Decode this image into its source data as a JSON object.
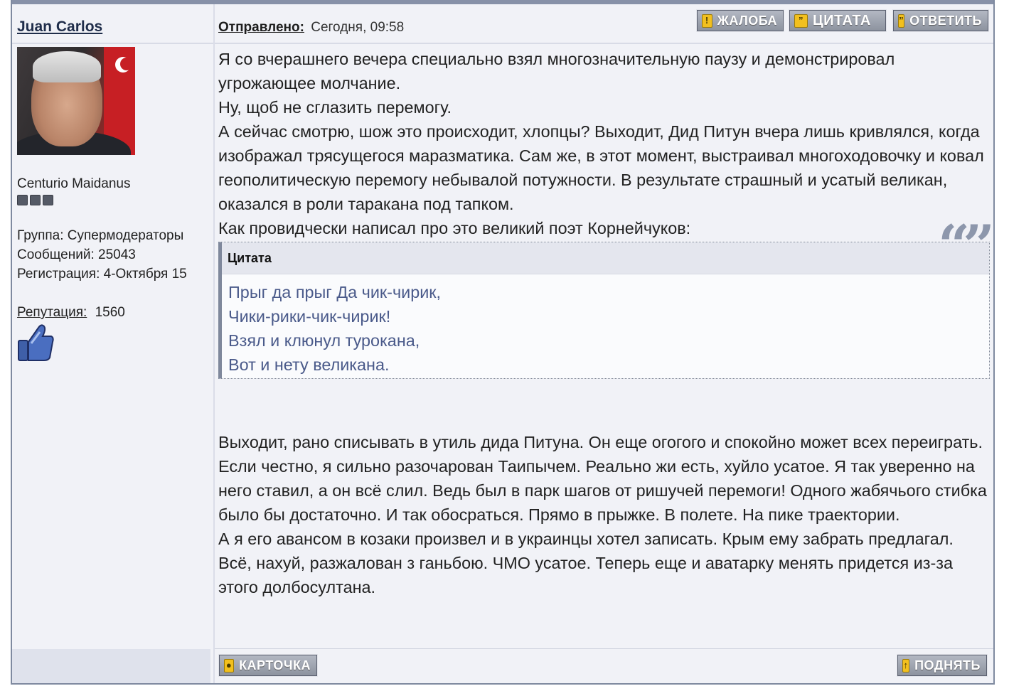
{
  "header": {
    "author": "Juan Carlos",
    "sent_label": "Отправлено:",
    "sent_time": "Сегодня, 09:58",
    "buttons": {
      "report": "ЖАЛОБА",
      "quote": "ЦИТАТА",
      "reply": "ОТВЕТИТЬ"
    }
  },
  "profile": {
    "rank": "Centurio Maidanus",
    "group": "Группа: Супермодераторы",
    "posts": "Сообщений: 25043",
    "registered": "Регистрация: 4-Октября 15",
    "reputation_label": "Репутация:",
    "reputation_value": "1560"
  },
  "post": {
    "paragraphs_top": [
      "Я со вчерашнего вечера специально взял многозначительную паузу и демонстрировал угрожающее молчание.",
      "Ну, щоб не сглазить перемогу.",
      "А сейчас смотрю, шож это происходит, хлопцы? Выходит, Дид Питун вчера лишь кривлялся, когда изображал трясущегося маразматика. Сам же, в этот момент, выстраивал многоходовочку и ковал геополитическую перемогу небывалой потужности. В результате страшный и усатый великан, оказался в роли таракана под тапком.",
      "Как провидчески написал про это великий поэт Корнейчуков:"
    ],
    "quote": {
      "title": "Цитата",
      "lines": [
        "Прыг да прыг Да чик-чирик,",
        "Чики-рики-чик-чирик!",
        "Взял и клюнул турокана,",
        "Вот и нету великана."
      ]
    },
    "paragraphs_bottom": [
      "Выходит, рано списывать в утиль дида Питуна. Он еще огогого и спокойно может всех переиграть.",
      "Если честно, я сильно разочарован Таипычем. Реально жи есть, хуйло усатое. Я так уверенно на него ставил, а он всё слил. Ведь был в парк шагов от ришучей перемоги! Одного жабячього стибка было бы достаточно. И так обосраться. Прямо в прыжке. В полете. На пике траектории.",
      "А я его авансом в козаки произвел и в украинцы хотел записать. Крым ему забрать предлагал. Всё, нахуй, разжалован з ганьбою. ЧМО усатое. Теперь еще и аватарку менять придется из-за этого долбосултана."
    ]
  },
  "footer": {
    "card": "КАРТОЧКА",
    "up": "ПОДНЯТЬ"
  },
  "colors": {
    "frame": "#7f8aa0",
    "background": "#f1f2f7",
    "quote_text": "#4a5a8a",
    "button_icon": "#f2c01e"
  }
}
